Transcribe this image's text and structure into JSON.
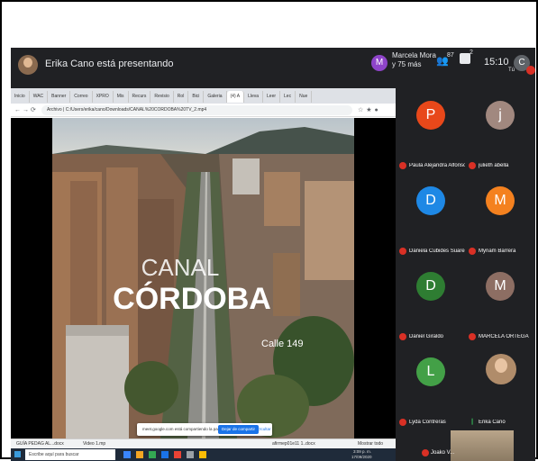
{
  "meet": {
    "presenter_text": "Erika Cano está presentando",
    "viewer": {
      "initial": "M",
      "name_line1": "Marcela Mora",
      "name_line2": "y 75 más"
    },
    "people_count": "87",
    "chat_count": "2",
    "clock": "15:10",
    "you": {
      "initial": "C",
      "label": "Tú"
    }
  },
  "browser": {
    "tabs": [
      "Inicio",
      "WAC",
      "Banner",
      "Correo",
      "XPRO",
      "Mis",
      "Recurs",
      "Revisio",
      "Rol",
      "Bici",
      "Galeria",
      "(4) A",
      "Lleva",
      "Leer",
      "Lec",
      "Nue"
    ],
    "address": "Archivo | C:/Users/erika/cano/Downloads/CANAL%20CORDOBA%20TV_2.mp4",
    "downloads": [
      "GUÍA PEDAG AL...docx",
      "Video 1.mp",
      "afirmep01e11 1..docx"
    ],
    "download_show_all": "Mostrar todo",
    "taskbar_search": "Escribe aquí para buscar",
    "taskbar_time": "3:09 p. m.",
    "taskbar_date": "17/09/2020"
  },
  "notification": {
    "text": "meet.google.com está compartiendo la pantalla",
    "stop_button": "Dejar de compartir",
    "hide": "Ocultar"
  },
  "video": {
    "title_line1": "CANAL",
    "title_line2": "CÓRDOBA",
    "street": "Calle 149"
  },
  "participants": [
    {
      "initial": "P",
      "name": "Paula Alejandra Alfonso ...",
      "color": "#e8481a"
    },
    {
      "initial": "j",
      "name": "julieth abella",
      "color": "#a1887f"
    },
    {
      "initial": "D",
      "name": "Daniela Cubides Suarez",
      "color": "#1e88e5"
    },
    {
      "initial": "M",
      "name": "Myriam Barrera",
      "color": "#f4811f"
    },
    {
      "initial": "D",
      "name": "Daniel Giraldo",
      "color": "#2e7d32"
    },
    {
      "initial": "M",
      "name": "MARCELA ORTEGA",
      "color": "#8d6e63"
    },
    {
      "initial": "L",
      "name": "Lyda Contreras",
      "color": "#43a047"
    },
    {
      "initial": "",
      "name": "Erika Cano",
      "color": ""
    }
  ],
  "joako": {
    "name": "Joako V..."
  }
}
